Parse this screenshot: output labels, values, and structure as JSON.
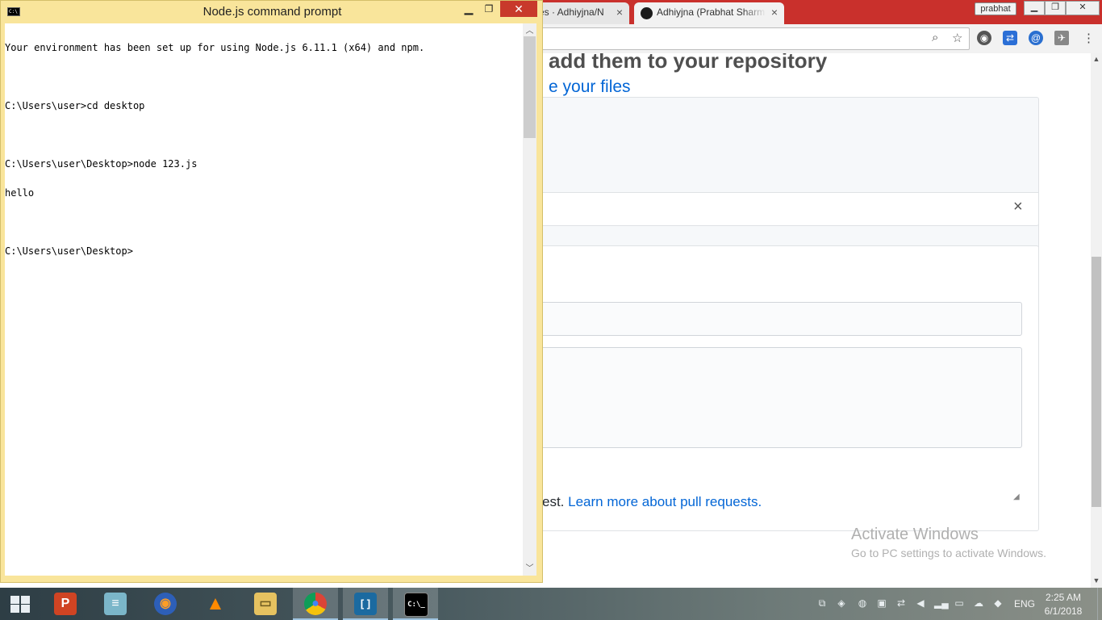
{
  "browser": {
    "tabs": [
      {
        "label": "es · Adhiyjna/N"
      },
      {
        "label": "Adhiyjna (Prabhat Sharm"
      }
    ],
    "tab_close_glyph": "×",
    "profile_name": "prabhat",
    "page": {
      "heading": "add them to your repository",
      "link": "e your files",
      "dismiss_glyph": "×",
      "pr_text_prefix": "est.",
      "pr_link": "Learn more about pull requests."
    },
    "watermark": {
      "title": "Activate Windows",
      "subtitle": "Go to PC settings to activate Windows."
    },
    "extension_icons": [
      "eye-extension-icon",
      "share-extension-icon",
      "at-extension-icon",
      "airplane-extension-icon",
      "menu-icon"
    ],
    "accent_color": "#c9302c"
  },
  "cmd": {
    "title": "Node.js command prompt",
    "lines": [
      "Your environment has been set up for using Node.js 6.11.1 (x64) and npm.",
      "",
      "C:\\Users\\user>cd desktop",
      "",
      "C:\\Users\\user\\Desktop>node 123.js",
      "hello",
      "",
      "C:\\Users\\user\\Desktop>"
    ],
    "frame_color": "#f9e59b"
  },
  "taskbar": {
    "apps": [
      {
        "name": "powerpoint-icon",
        "glyph": "P"
      },
      {
        "name": "notepad-icon",
        "glyph": "≡"
      },
      {
        "name": "firefox-icon",
        "glyph": "◉"
      },
      {
        "name": "vlc-icon",
        "glyph": "▲"
      },
      {
        "name": "file-explorer-icon",
        "glyph": "▭"
      },
      {
        "name": "chrome-icon",
        "glyph": "●"
      },
      {
        "name": "brackets-icon",
        "glyph": "[ ]"
      },
      {
        "name": "cmd-icon",
        "glyph": "C:\\_"
      }
    ],
    "language": "ENG",
    "time": "2:25 AM",
    "date": "6/1/2018"
  }
}
